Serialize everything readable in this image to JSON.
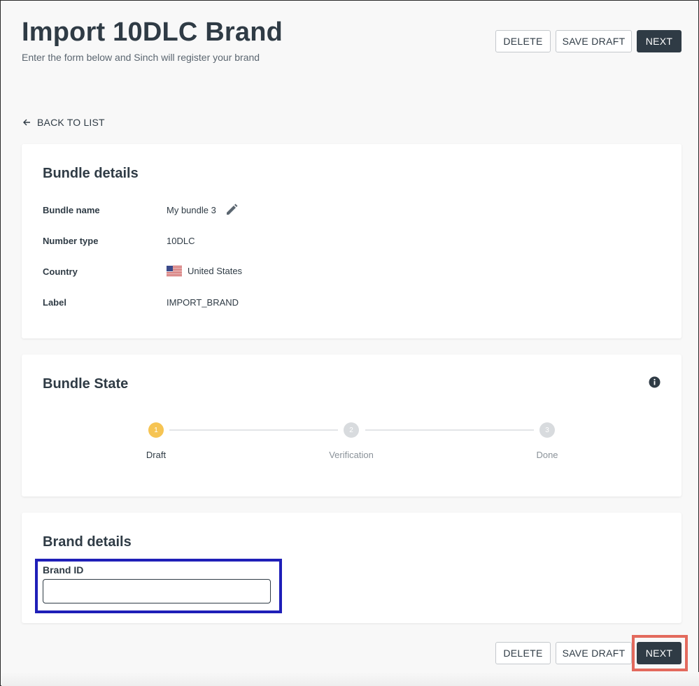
{
  "header": {
    "title": "Import 10DLC Brand",
    "subtitle": "Enter the form below and Sinch will register your brand",
    "delete_label": "DELETE",
    "save_draft_label": "SAVE DRAFT",
    "next_label": "NEXT"
  },
  "back_link": {
    "label": "BACK TO LIST",
    "icon": "arrow-left-icon"
  },
  "bundle_details": {
    "title": "Bundle details",
    "rows": [
      {
        "label": "Bundle name",
        "value": "My bundle 3"
      },
      {
        "label": "Number type",
        "value": "10DLC"
      },
      {
        "label": "Country",
        "value": "United States"
      },
      {
        "label": "Label",
        "value": "IMPORT_BRAND"
      }
    ],
    "edit_icon": "pencil-icon",
    "flag_icon": "us-flag-icon"
  },
  "bundle_state": {
    "title": "Bundle State",
    "info_icon": "info-icon",
    "steps": [
      {
        "number": "1",
        "label": "Draft",
        "active": true
      },
      {
        "number": "2",
        "label": "Verification",
        "active": false
      },
      {
        "number": "3",
        "label": "Done",
        "active": false
      }
    ],
    "active_color": "#f6c453",
    "inactive_color": "#d8dbde"
  },
  "brand_details": {
    "title": "Brand details",
    "brand_id_label": "Brand ID",
    "brand_id_value": ""
  },
  "footer": {
    "delete_label": "DELETE",
    "save_draft_label": "SAVE DRAFT",
    "next_label": "NEXT"
  },
  "colors": {
    "primary": "#2f3b45",
    "highlight_blue": "#1f1fb8",
    "highlight_red": "#e36a5d"
  }
}
